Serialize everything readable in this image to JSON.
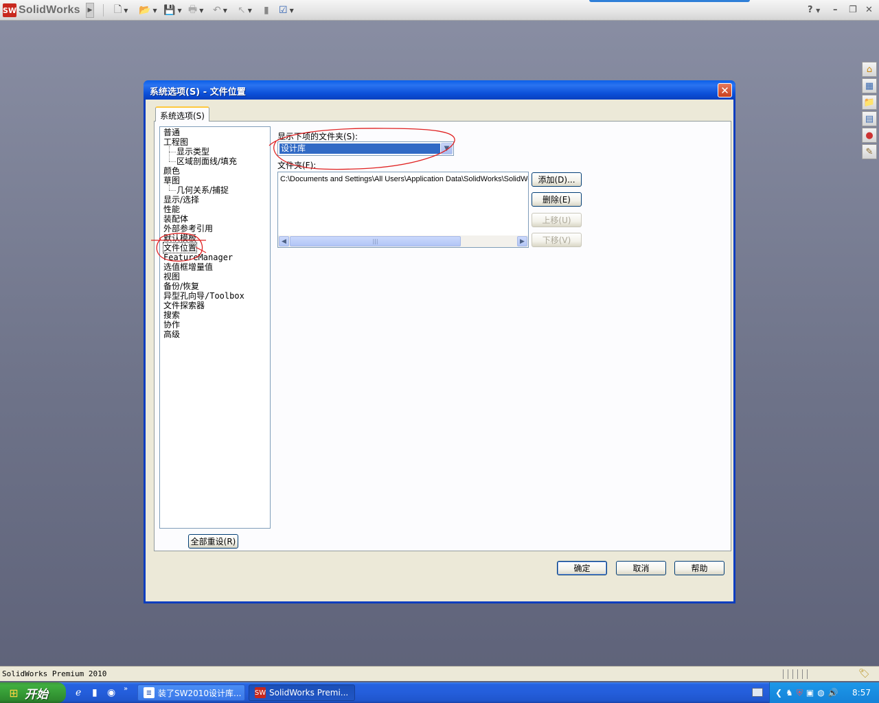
{
  "app": {
    "logo_mark": "SW",
    "logo_text": "SolidWorks",
    "help_icon": "?"
  },
  "dialog": {
    "title": "系统选项(S) - 文件位置",
    "tab_label": "系统选项(S)",
    "tree": [
      {
        "label": "普通",
        "level": 1
      },
      {
        "label": "工程图",
        "level": 1
      },
      {
        "label": "显示类型",
        "level": 2
      },
      {
        "label": "区域剖面线/填充",
        "level": 2
      },
      {
        "label": "颜色",
        "level": 1
      },
      {
        "label": "草图",
        "level": 1
      },
      {
        "label": "几何关系/捕捉",
        "level": 2
      },
      {
        "label": "显示/选择",
        "level": 1
      },
      {
        "label": "性能",
        "level": 1
      },
      {
        "label": "装配体",
        "level": 1
      },
      {
        "label": "外部参考引用",
        "level": 1
      },
      {
        "label": "默认模板",
        "level": 1
      },
      {
        "label": "文件位置",
        "level": 1,
        "selected": true
      },
      {
        "label": "FeatureManager",
        "level": 1
      },
      {
        "label": "选值框增量值",
        "level": 1
      },
      {
        "label": "视图",
        "level": 1
      },
      {
        "label": "备份/恢复",
        "level": 1
      },
      {
        "label": "异型孔向导/Toolbox",
        "level": 1
      },
      {
        "label": "文件探索器",
        "level": 1
      },
      {
        "label": "搜索",
        "level": 1
      },
      {
        "label": "协作",
        "level": 1
      },
      {
        "label": "高级",
        "level": 1
      }
    ],
    "reset_all_label": "全部重设(R)",
    "show_folders_label": "显示下项的文件夹(S):",
    "show_folders_value": "设计库",
    "folders_label": "文件夹(F):",
    "folder_paths": [
      "C:\\Documents and Settings\\All Users\\Application Data\\SolidWorks\\SolidWor"
    ],
    "add_label": "添加(D)...",
    "delete_label": "删除(E)",
    "move_up_label": "上移(U)",
    "move_down_label": "下移(V)",
    "ok_label": "确定",
    "cancel_label": "取消",
    "help_label": "帮助"
  },
  "statusbar": {
    "text": "SolidWorks Premium 2010"
  },
  "taskbar": {
    "start_label": "开始",
    "tasks": [
      {
        "label": "装了SW2010设计库...",
        "active": false
      },
      {
        "label": "SolidWorks Premi...",
        "active": true
      }
    ],
    "clock": "8:57"
  },
  "colors": {
    "dialog_title": "#0a4fd8",
    "selection": "#316ac5",
    "annotation": "#e02020"
  }
}
